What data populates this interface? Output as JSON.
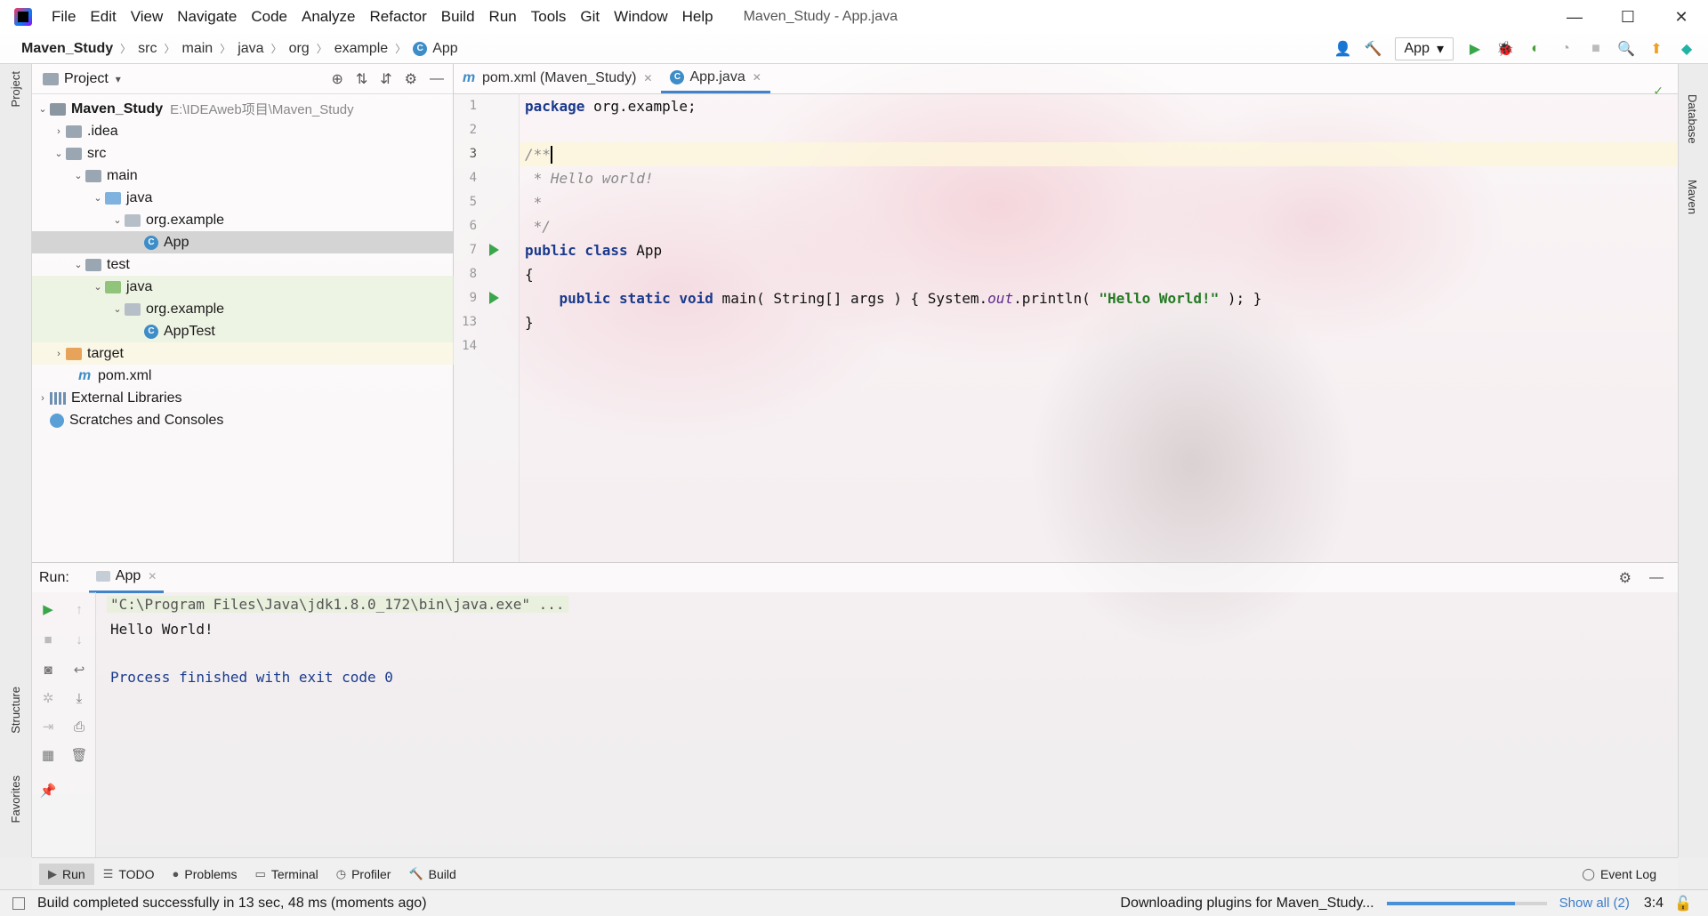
{
  "window": {
    "title": "Maven_Study - App.java",
    "menu": [
      "File",
      "Edit",
      "View",
      "Navigate",
      "Code",
      "Analyze",
      "Refactor",
      "Build",
      "Run",
      "Tools",
      "Git",
      "Window",
      "Help"
    ],
    "controls": {
      "minimize": "—",
      "maximize": "☐",
      "close": "✕"
    }
  },
  "breadcrumb": [
    "Maven_Study",
    "src",
    "main",
    "java",
    "org",
    "example",
    "App"
  ],
  "toolbar": {
    "run_config": "App"
  },
  "left_stripe": {
    "project": "Project",
    "structure": "Structure",
    "favorites": "Favorites"
  },
  "right_stripe": {
    "database": "Database",
    "maven": "Maven"
  },
  "project_panel": {
    "title": "Project",
    "tree": [
      {
        "label": "Maven_Study",
        "hint": "E:\\IDEAweb项目\\Maven_Study"
      },
      {
        "label": ".idea"
      },
      {
        "label": "src"
      },
      {
        "label": "main"
      },
      {
        "label": "java"
      },
      {
        "label": "org.example"
      },
      {
        "label": "App"
      },
      {
        "label": "test"
      },
      {
        "label": "java"
      },
      {
        "label": "org.example"
      },
      {
        "label": "AppTest"
      },
      {
        "label": "target"
      },
      {
        "label": "pom.xml"
      },
      {
        "label": "External Libraries"
      },
      {
        "label": "Scratches and Consoles"
      }
    ]
  },
  "editor": {
    "tabs": [
      {
        "label": "pom.xml (Maven_Study)"
      },
      {
        "label": "App.java"
      }
    ],
    "line_numbers": [
      "1",
      "2",
      "3",
      "4",
      "5",
      "6",
      "7",
      "8",
      "9",
      "13",
      "14"
    ],
    "code": {
      "l1_kw": "package",
      "l1_rest": " org.example;",
      "l3": "/**",
      "l4": " * Hello world!",
      "l5": " *",
      "l6": " */",
      "l7_kw": "public class",
      "l7_rest": " App",
      "l8": "{",
      "l9_kw": "    public static void",
      "l9_a": " main( String[] args ) { System.",
      "l9_out": "out",
      "l9_b": ".println( ",
      "l9_str": "\"Hello World!\"",
      "l9_c": " ); }",
      "l13": "}"
    }
  },
  "run_window": {
    "label": "Run:",
    "tab": "App",
    "console": {
      "cmd": "\"C:\\Program Files\\Java\\jdk1.8.0_172\\bin\\java.exe\" ...",
      "out": "Hello World!",
      "finished": "Process finished with exit code 0"
    }
  },
  "tool_windows": [
    {
      "label": "Run"
    },
    {
      "label": "TODO"
    },
    {
      "label": "Problems"
    },
    {
      "label": "Terminal"
    },
    {
      "label": "Profiler"
    },
    {
      "label": "Build"
    }
  ],
  "event_log": "Event Log",
  "status_bar": {
    "message": "Build completed successfully in 13 sec, 48 ms (moments ago)",
    "task": "Downloading plugins for Maven_Study...",
    "progress_fraction": 0.8,
    "show_all": "Show all (2)",
    "position": "3:4"
  }
}
